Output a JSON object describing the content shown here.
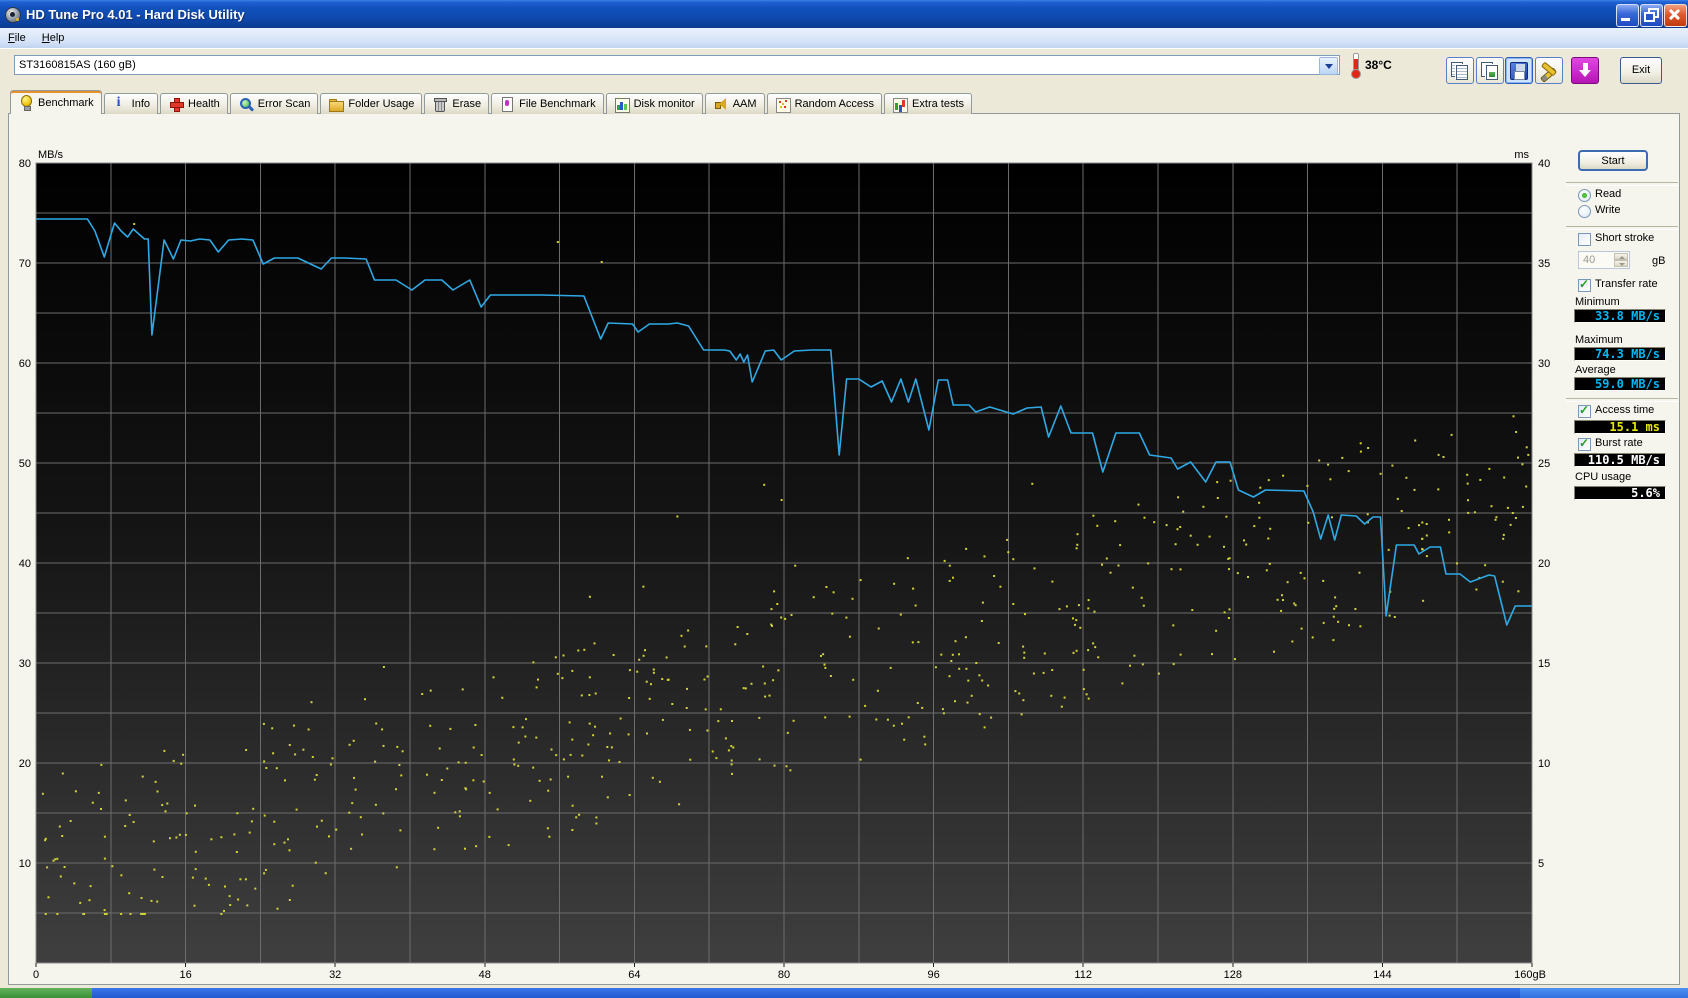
{
  "window": {
    "title": "HD Tune Pro 4.01 - Hard Disk Utility"
  },
  "menu": {
    "items": [
      "File",
      "Help"
    ]
  },
  "toolbar": {
    "drive_selector": "ST3160815AS (160 gB)",
    "temperature": "38°C",
    "buttons": [
      {
        "name": "copy-text-button",
        "icon": "copy-icon",
        "pressed": false
      },
      {
        "name": "copy-image-button",
        "icon": "copy-image-icon",
        "pressed": false
      },
      {
        "name": "save-button",
        "icon": "save-icon",
        "pressed": true
      },
      {
        "name": "options-button",
        "icon": "tools-icon",
        "pressed": false
      },
      {
        "name": "update-button",
        "icon": "download-icon",
        "pressed": false
      }
    ],
    "exit_label": "Exit"
  },
  "tabs": [
    {
      "label": "Benchmark",
      "icon": "benchmark-icon",
      "style": "benchmark",
      "active": true
    },
    {
      "label": "Info",
      "icon": "info-icon",
      "style": "info",
      "active": false
    },
    {
      "label": "Health",
      "icon": "health-icon",
      "style": "health",
      "active": false
    },
    {
      "label": "Error Scan",
      "icon": "error-scan-icon",
      "style": "scan",
      "active": false
    },
    {
      "label": "Folder Usage",
      "icon": "folder-icon",
      "style": "folder",
      "active": false
    },
    {
      "label": "Erase",
      "icon": "erase-icon",
      "style": "erase",
      "active": false
    },
    {
      "label": "File Benchmark",
      "icon": "file-benchmark-icon",
      "style": "filebench",
      "active": false
    },
    {
      "label": "Disk monitor",
      "icon": "disk-monitor-icon",
      "style": "diskmon",
      "active": false
    },
    {
      "label": "AAM",
      "icon": "aam-icon",
      "style": "aam",
      "active": false
    },
    {
      "label": "Random Access",
      "icon": "random-access-icon",
      "style": "random",
      "active": false
    },
    {
      "label": "Extra tests",
      "icon": "extra-tests-icon",
      "style": "extra",
      "active": false
    }
  ],
  "side_panel": {
    "start_label": "Start",
    "read_label": "Read",
    "write_label": "Write",
    "short_stroke_label": "Short stroke",
    "short_stroke_value": "40",
    "short_stroke_unit": "gB",
    "transfer_rate_label": "Transfer rate",
    "minimum_label": "Minimum",
    "minimum_value": "33.8 MB/s",
    "maximum_label": "Maximum",
    "maximum_value": "74.3 MB/s",
    "average_label": "Average",
    "average_value": "59.0 MB/s",
    "access_time_label": "Access time",
    "access_time_value": "15.1 ms",
    "burst_rate_label": "Burst rate",
    "burst_rate_value": "110.5 MB/s",
    "cpu_usage_label": "CPU usage",
    "cpu_usage_value": "5.6%"
  },
  "chart_data": {
    "type": "line+scatter",
    "left_axis": {
      "label": "MB/s",
      "min": 0,
      "max": 80,
      "ticks": [
        80,
        70,
        60,
        50,
        40,
        30,
        20,
        10
      ]
    },
    "right_axis": {
      "label": "ms",
      "min": 0,
      "max": 40,
      "ticks": [
        40,
        35,
        30,
        25,
        20,
        15,
        10,
        5
      ]
    },
    "x_axis": {
      "min": 0,
      "max": 160,
      "tick_values": [
        0,
        16,
        32,
        48,
        64,
        80,
        96,
        112,
        128,
        144
      ],
      "end_label": "160gB",
      "grid_step": 8
    },
    "grid": {
      "x_step_gb": 8,
      "y_step_mbs": 5,
      "color": "#6c6c6c"
    },
    "transfer_rate_series": {
      "name": "Transfer rate",
      "unit": "MB/s",
      "color": "#2fa9e5",
      "points": [
        [
          0,
          74.4
        ],
        [
          4,
          74.4
        ],
        [
          5.5,
          74.4
        ],
        [
          6.3,
          73.2
        ],
        [
          7.3,
          70.6
        ],
        [
          8.4,
          74.0
        ],
        [
          9.1,
          73.2
        ],
        [
          9.8,
          72.6
        ],
        [
          10.4,
          73.4
        ],
        [
          11,
          72.9
        ],
        [
          11.6,
          72.4
        ],
        [
          12,
          72.4
        ],
        [
          12.4,
          62.8
        ],
        [
          13.7,
          72.3
        ],
        [
          14.7,
          70.4
        ],
        [
          15.5,
          72.3
        ],
        [
          16.5,
          72.2
        ],
        [
          17.5,
          72.4
        ],
        [
          18.6,
          72.3
        ],
        [
          19.5,
          71.1
        ],
        [
          20.6,
          72.3
        ],
        [
          22,
          72.4
        ],
        [
          23.2,
          72.3
        ],
        [
          24.3,
          69.9
        ],
        [
          25.5,
          70.5
        ],
        [
          28,
          70.5
        ],
        [
          30.5,
          69.4
        ],
        [
          31.6,
          70.5
        ],
        [
          33,
          70.5
        ],
        [
          35.3,
          70.4
        ],
        [
          36.2,
          68.3
        ],
        [
          38.5,
          68.3
        ],
        [
          40.2,
          67.3
        ],
        [
          41.6,
          68.3
        ],
        [
          43.4,
          68.3
        ],
        [
          44.6,
          67.3
        ],
        [
          46.4,
          68.3
        ],
        [
          47.6,
          65.6
        ],
        [
          48.6,
          66.8
        ],
        [
          51,
          66.8
        ],
        [
          54,
          66.8
        ],
        [
          58.6,
          66.7
        ],
        [
          60.4,
          62.4
        ],
        [
          61.2,
          64.0
        ],
        [
          63.8,
          63.9
        ],
        [
          64.4,
          63.1
        ],
        [
          65.6,
          63.9
        ],
        [
          67.6,
          63.9
        ],
        [
          68.6,
          64.0
        ],
        [
          69.8,
          63.7
        ],
        [
          71.4,
          61.3
        ],
        [
          73.6,
          61.3
        ],
        [
          74.2,
          61.2
        ],
        [
          74.9,
          60.3
        ],
        [
          75.3,
          60.9
        ],
        [
          75.7,
          60.1
        ],
        [
          76.1,
          60.8
        ],
        [
          76.6,
          58.1
        ],
        [
          78,
          61.2
        ],
        [
          78.9,
          61.3
        ],
        [
          79.7,
          60.3
        ],
        [
          81.1,
          61.2
        ],
        [
          83,
          61.3
        ],
        [
          85,
          61.3
        ],
        [
          85.9,
          50.8
        ],
        [
          86.7,
          58.4
        ],
        [
          88,
          58.4
        ],
        [
          89.3,
          57.6
        ],
        [
          90.5,
          58.2
        ],
        [
          91.5,
          56.1
        ],
        [
          92.5,
          58.4
        ],
        [
          93.3,
          56.1
        ],
        [
          94.1,
          58.4
        ],
        [
          95.5,
          53.3
        ],
        [
          96.5,
          58.3
        ],
        [
          97.5,
          58.3
        ],
        [
          98.1,
          55.8
        ],
        [
          99.8,
          55.8
        ],
        [
          100.5,
          55.1
        ],
        [
          102,
          55.6
        ],
        [
          104.5,
          54.9
        ],
        [
          106,
          55.5
        ],
        [
          107.5,
          55.6
        ],
        [
          108.3,
          52.6
        ],
        [
          109.6,
          55.7
        ],
        [
          110.7,
          53.0
        ],
        [
          113,
          53.0
        ],
        [
          114.1,
          49.1
        ],
        [
          115.5,
          53.0
        ],
        [
          118,
          53.0
        ],
        [
          119.1,
          50.8
        ],
        [
          121.4,
          50.5
        ],
        [
          122.1,
          49.4
        ],
        [
          123.5,
          50.1
        ],
        [
          125.1,
          48.1
        ],
        [
          126.2,
          50.1
        ],
        [
          127.7,
          50.1
        ],
        [
          128.6,
          47.3
        ],
        [
          130.2,
          46.6
        ],
        [
          131.5,
          47.3
        ],
        [
          135.6,
          47.2
        ],
        [
          136.6,
          45.1
        ],
        [
          137.4,
          42.4
        ],
        [
          138.2,
          44.8
        ],
        [
          138.9,
          42.3
        ],
        [
          139.6,
          44.8
        ],
        [
          141.2,
          44.7
        ],
        [
          142.1,
          43.9
        ],
        [
          143,
          44.6
        ],
        [
          143.8,
          44.6
        ],
        [
          144.4,
          34.7
        ],
        [
          145.5,
          41.8
        ],
        [
          147.4,
          41.8
        ],
        [
          147.9,
          40.9
        ],
        [
          149.1,
          41.6
        ],
        [
          150.2,
          41.6
        ],
        [
          150.8,
          38.9
        ],
        [
          152.3,
          38.9
        ],
        [
          153.4,
          38.1
        ],
        [
          155.4,
          38.8
        ],
        [
          156,
          38.7
        ],
        [
          157.3,
          33.8
        ],
        [
          158.2,
          35.7
        ],
        [
          160,
          35.7
        ]
      ]
    },
    "access_time_scatter": {
      "name": "Access time",
      "unit": "ms",
      "color": "#d2d23a",
      "approximate": true,
      "generator": {
        "seed": 1337,
        "count": 600,
        "x_min": 0.5,
        "x_max": 159.5,
        "ms_at_0": 4.5,
        "ms_at_160": 23.5,
        "spread": 4.8,
        "outlier_rate": 0.07,
        "outlier_extra": 7,
        "ms_min": 2.5,
        "ms_max": 37
      },
      "fixed_points": [
        [
          10.4,
          37.0
        ],
        [
          55.7,
          36.1
        ],
        [
          60.4,
          35.1
        ]
      ]
    }
  }
}
